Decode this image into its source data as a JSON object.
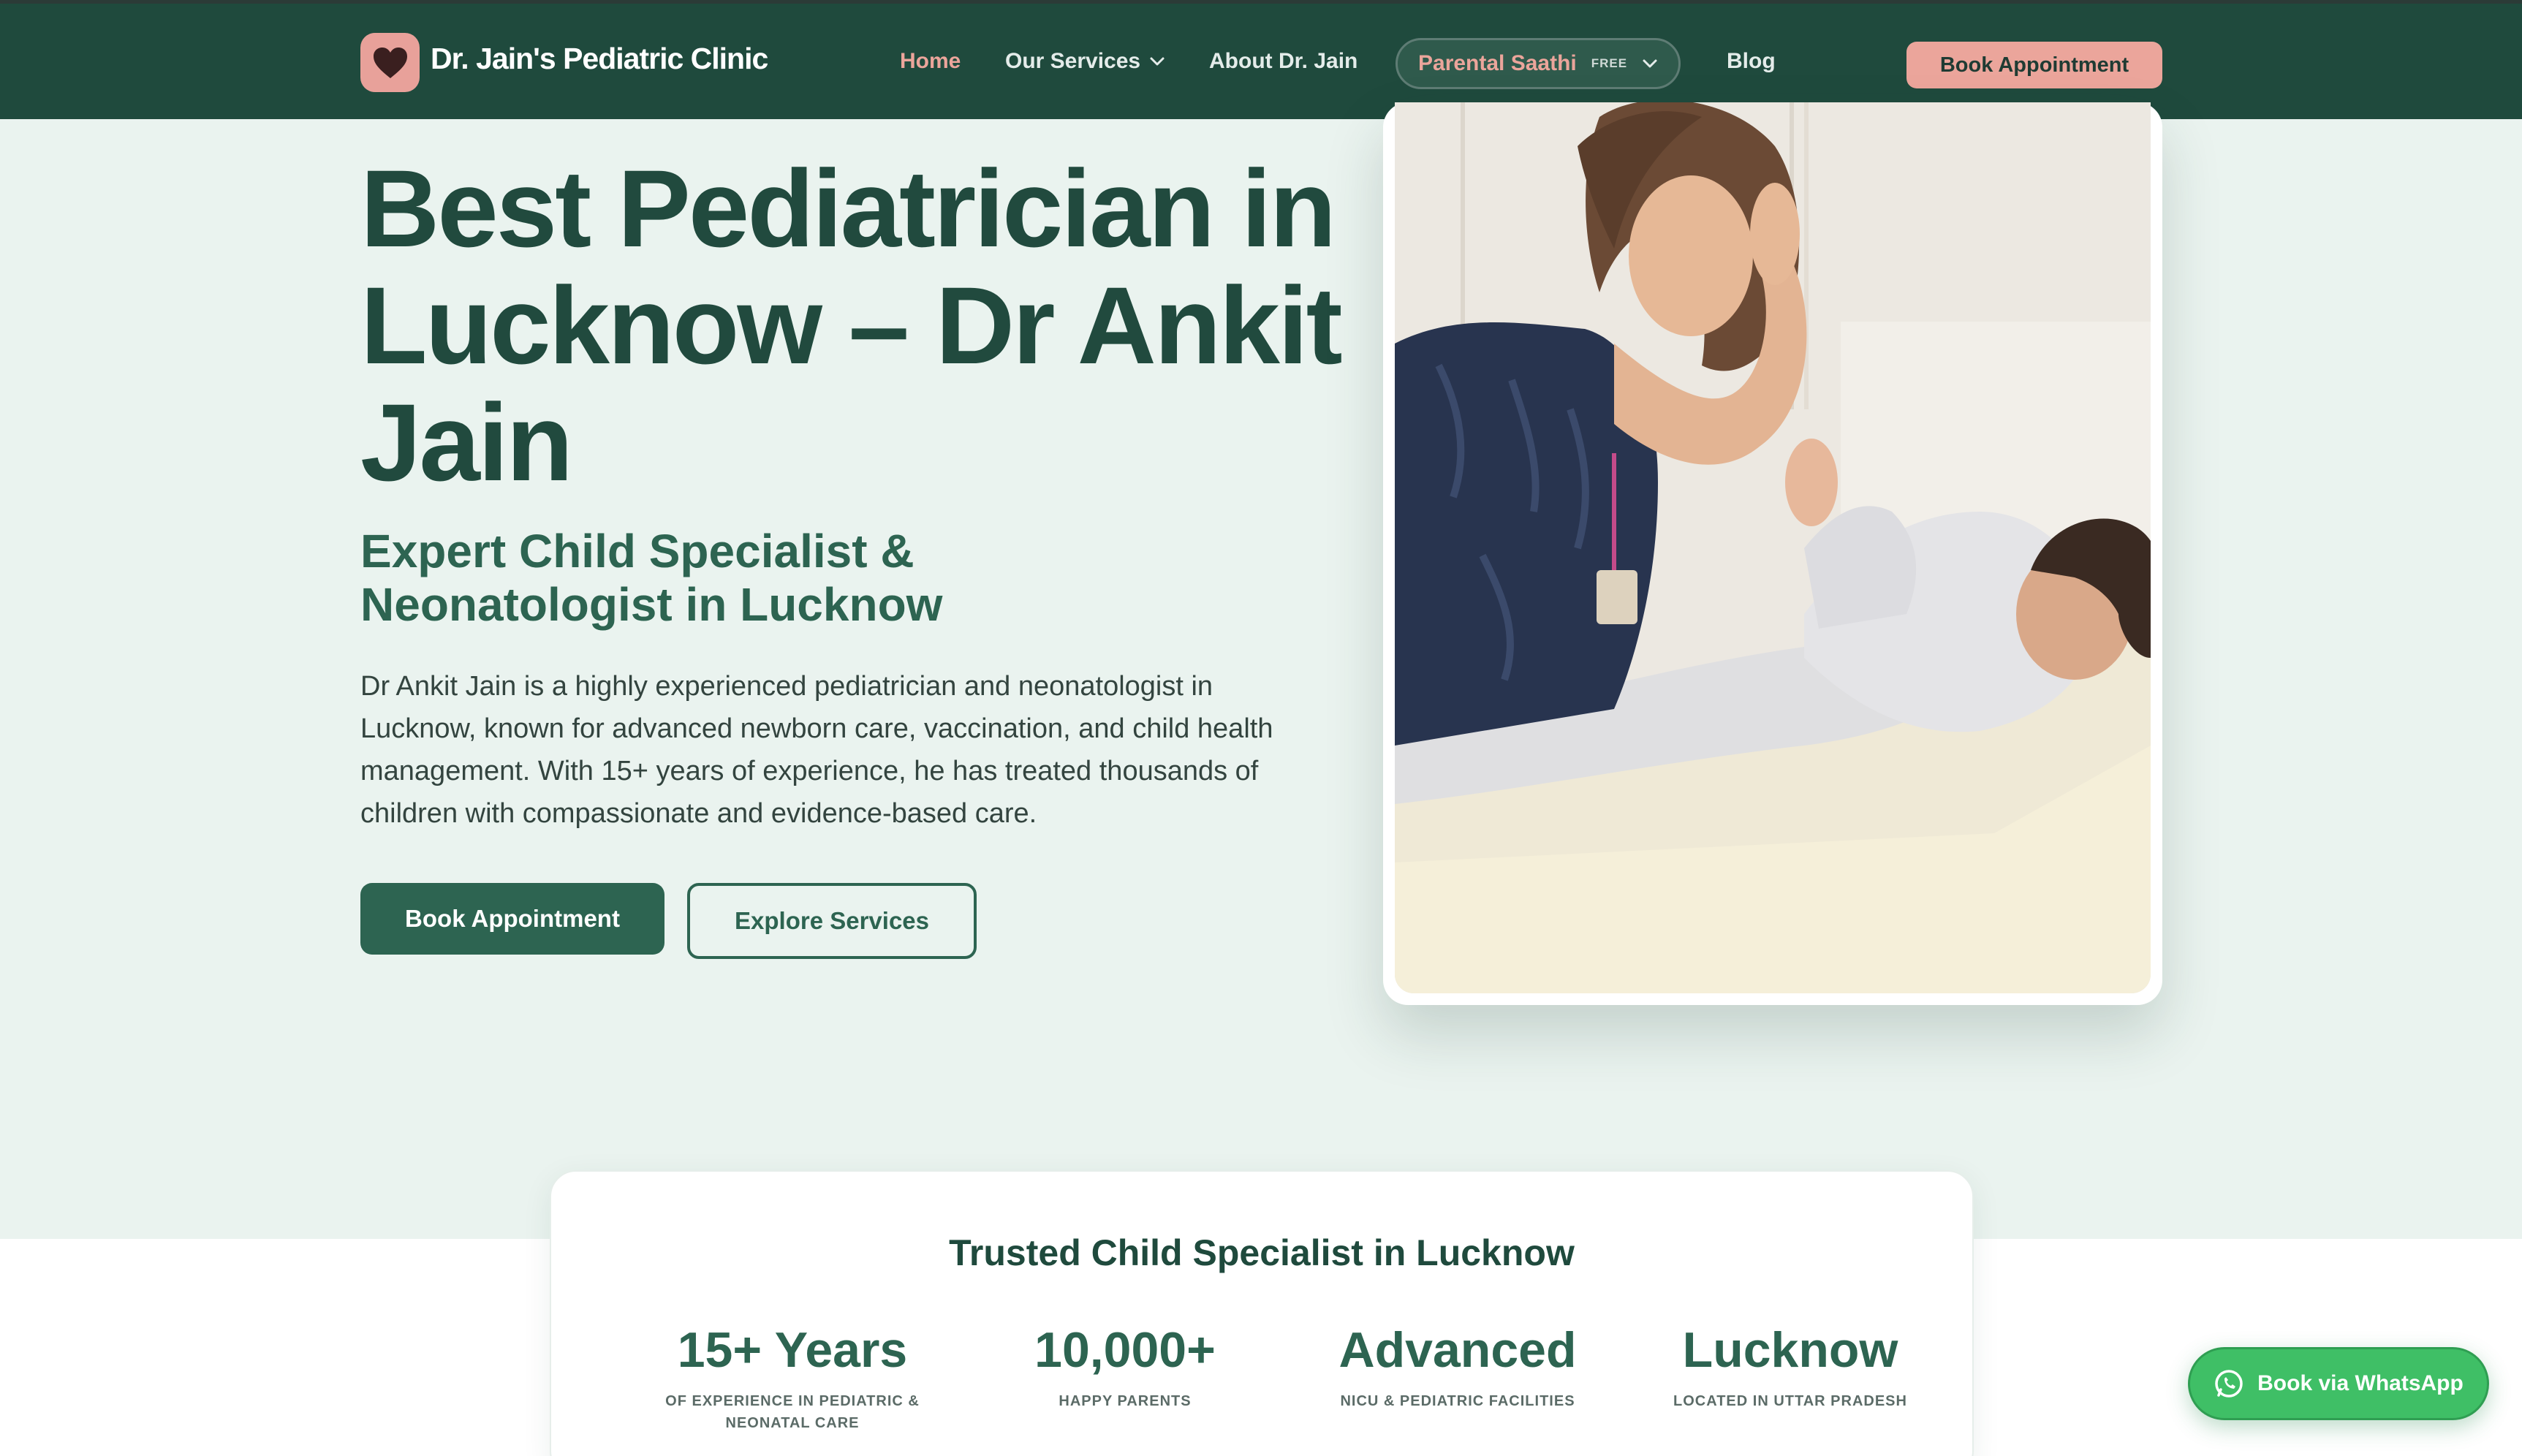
{
  "header": {
    "brand": "Dr. Jain's Pediatric Clinic",
    "nav": {
      "home": "Home",
      "services": "Our Services",
      "about": "About Dr. Jain",
      "parental": "Parental Saathi",
      "parental_badge": "FREE",
      "blog": "Blog"
    },
    "cta": "Book Appointment"
  },
  "hero": {
    "title": "Best Pediatrician in Lucknow – Dr Ankit Jain",
    "subtitle": "Expert Child Specialist & Neonatologist in Lucknow",
    "description": "Dr Ankit Jain is a highly experienced pediatrician and neonatologist in Lucknow, known for advanced newborn care, vaccination, and child health management. With 15+ years of experience, he has treated thousands of children with compassionate and evidence-based care.",
    "primary_button": "Book Appointment",
    "secondary_button": "Explore Services"
  },
  "trust": {
    "title": "Trusted Child Specialist in Lucknow",
    "stats": [
      {
        "value": "15+ Years",
        "label": "OF EXPERIENCE IN PEDIATRIC & NEONATAL CARE"
      },
      {
        "value": "10,000+",
        "label": "HAPPY PARENTS"
      },
      {
        "value": "Advanced",
        "label": "NICU & PEDIATRIC FACILITIES"
      },
      {
        "value": "Lucknow",
        "label": "LOCATED IN UTTAR PRADESH"
      }
    ]
  },
  "whatsapp": {
    "label": "Book via WhatsApp"
  },
  "colors": {
    "nav_bg": "#1f4a3d",
    "accent_pink": "#eba59b",
    "primary_green": "#2d6451",
    "hero_bg": "#eaf3ef",
    "whatsapp_green": "#3fbf66"
  }
}
